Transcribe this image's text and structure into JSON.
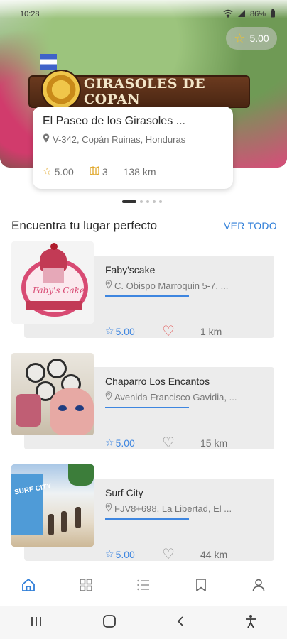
{
  "status_bar": {
    "time": "10:28",
    "battery": "86%"
  },
  "hero": {
    "sign_text": "GIRASOLES DE COPAN",
    "rating": "5.00",
    "card": {
      "title": "El Paseo de los Girasoles ...",
      "location": "V-342, Copán Ruinas, Honduras",
      "rating": "5.00",
      "count": "3",
      "distance": "138 km"
    },
    "carousel": {
      "total": 5,
      "active_index": 0
    }
  },
  "section": {
    "title": "Encuentra tu lugar perfecto",
    "see_all": "VER TODO"
  },
  "places": [
    {
      "name": "Faby'scake",
      "address": "C. Obispo Marroquin 5-7, ...",
      "rating": "5.00",
      "favorite": true,
      "distance": "1 km",
      "thumb_text": "Faby's Cake"
    },
    {
      "name": "Chaparro Los Encantos",
      "address": "Avenida Francisco Gavidia, ...",
      "rating": "5.00",
      "favorite": false,
      "distance": "15 km"
    },
    {
      "name": "Surf City",
      "address": "FJV8+698, La Libertad, El ...",
      "rating": "5.00",
      "favorite": false,
      "distance": "44 km",
      "thumb_text": "SURF CITY"
    }
  ],
  "bottom_nav": {
    "items": [
      "home",
      "categories",
      "list",
      "saved",
      "profile"
    ],
    "active": "home",
    "active_color": "#2f7ed8"
  }
}
